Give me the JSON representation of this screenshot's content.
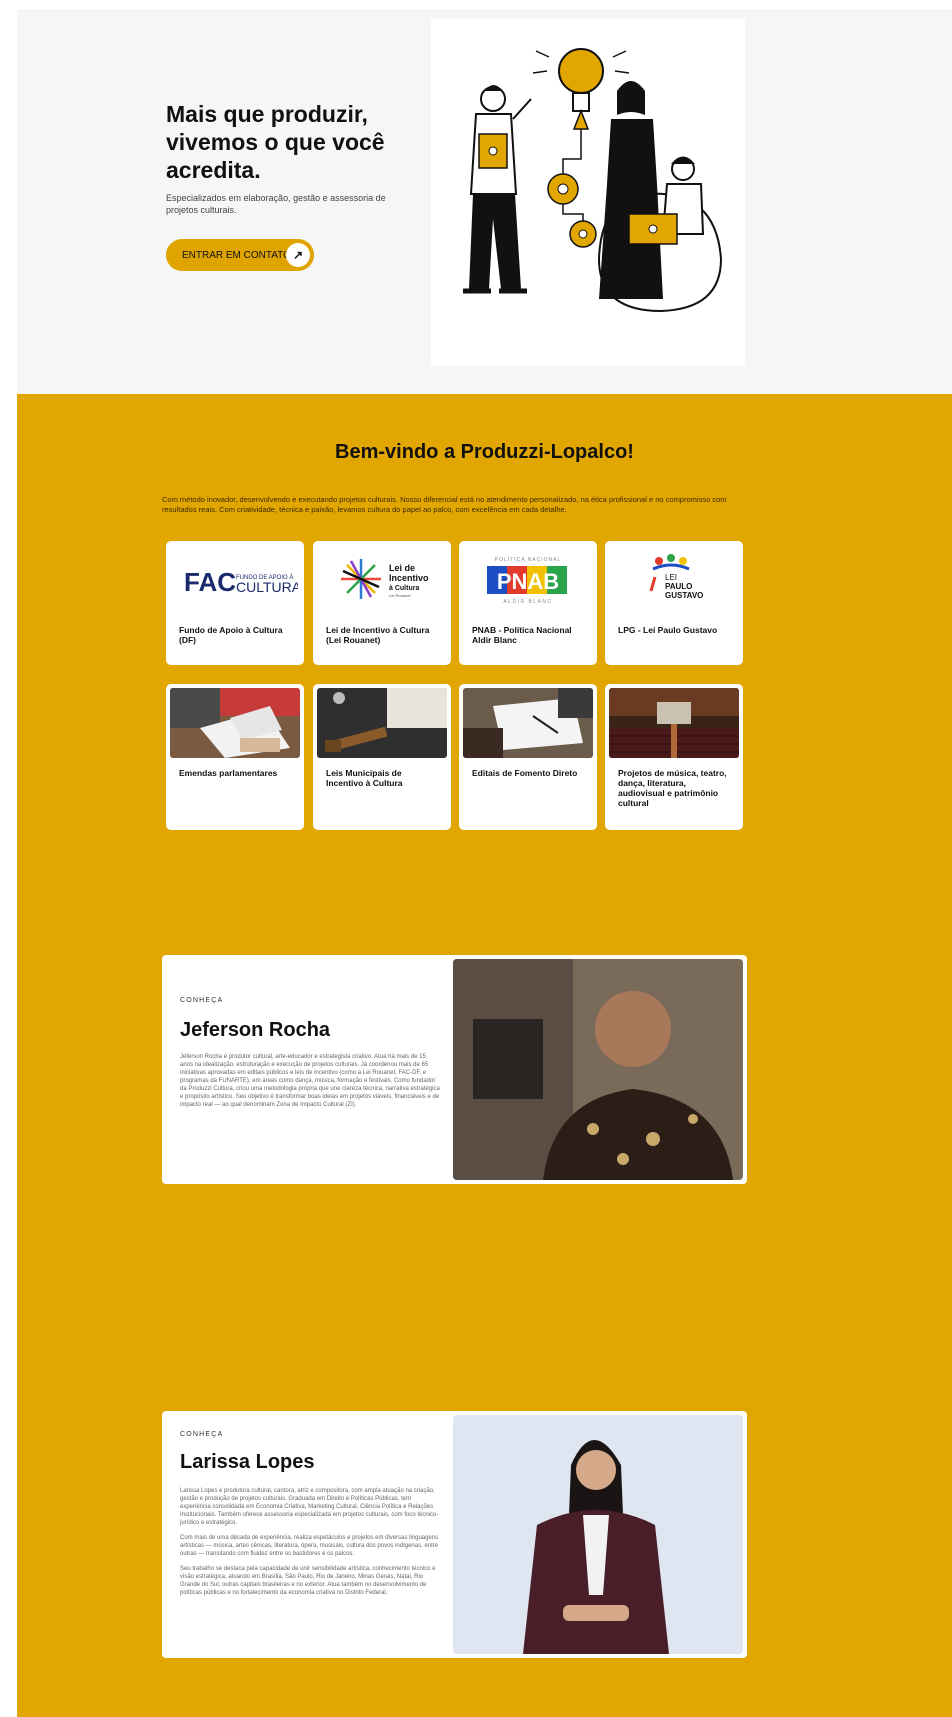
{
  "hero": {
    "title": "Mais que produzir, vivemos o que você acredita.",
    "subtitle": "Especializados em elaboração, gestão e assessoria de projetos culturais.",
    "cta_label": "ENTRAR EM CONTATO",
    "cta_icon": "arrow-up-right-icon"
  },
  "welcome": {
    "title": "Bem-vindo a Produzzi-Lopalco!",
    "text": "Com método inovador, desenvolvendo e executando projetos culturais. Nosso diferencial está no atendimento personalizado, na ética profissional e no compromisso com resultados reais. Com criatividade, técnica e paixão, levamos cultura do papel ao palco, com excelência em cada detalhe."
  },
  "cards": [
    {
      "label": "Fundo de Apoio à Cultura (DF)",
      "logo_main": "FAC",
      "logo_small_top": "FUNDO DE APOIO À",
      "logo_small_bottom": "CULTURA"
    },
    {
      "label": "Lei de Incentivo à Cultura (Lei Rouanet)",
      "logo_line1": "Lei de",
      "logo_line2": "Incentivo",
      "logo_line3": "à Cultura",
      "logo_line4": "Lei Rouanet"
    },
    {
      "label": "PNAB - Política Nacional Aldir Blanc",
      "logo_top": "POLÍTICA NACIONAL",
      "logo_main": "PNAB",
      "logo_bottom": "ALDIR BLANC"
    },
    {
      "label": "LPG - Lei Paulo Gustavo",
      "logo_line1": "LEI",
      "logo_line2": "PAULO",
      "logo_line3": "GUSTAVO"
    },
    {
      "label": "Emendas parlamentares"
    },
    {
      "label": "Leis Municipais de Incentivo à Cultura"
    },
    {
      "label": "Editais de Fomento Direto"
    },
    {
      "label": "Projetos de música, teatro, dança, literatura, audiovisual e patrimônio cultural"
    }
  ],
  "profiles": [
    {
      "kicker": "CONHEÇA",
      "name": "Jeferson Rocha",
      "bio": [
        "Jeferson Rocha é produtor cultural, arte-educador e estrategista criativo. Atua há mais de 15 anos na idealização, estruturação e execução de projetos culturais. Já coordenou mais de 65 iniciativas aprovadas em editais públicos e leis de incentivo (como a Lei Rouanet, FAC-DF, e programas da FUNARTE), em áreas como dança, música, formação e festivais. Como fundador da Produzzi Cultura, criou uma metodologia própria que une clareza técnica, narrativa estratégica e propósito artístico. Seu objetivo é transformar boas ideias em projetos viáveis, financiáveis e de impacto real — ao qual denominam Zona de Impacto Cultural (ZI)."
      ]
    },
    {
      "kicker": "CONHEÇA",
      "name": "Larissa Lopes",
      "bio": [
        "Larissa Lopes é produtora cultural, cantora, atriz e compositora, com ampla atuação na criação, gestão e produção de projetos culturais. Graduada em Direito e Políticas Públicas, tem experiência consolidada em Economia Criativa, Marketing Cultural, Ciência Política e Relações Institucionais. Também oferece assessoria especializada em projetos culturais, com foco técnico-jurídico e estratégico.",
        "Com mais de uma década de experiência, realiza espetáculos e projetos em diversas linguagens artísticas — música, artes cênicas, literatura, ópera, musicais, cultura dos povos indígenas, entre outras — transitando com fluidez entre os bastidores e os palcos.",
        "Seu trabalho se destaca pela capacidade de unir sensibilidade artística, conhecimento técnico e visão estratégica, atuando em Brasília, São Paulo, Rio de Janeiro, Minas Gerais, Natal, Rio Grande do Sul, outras capitais brasileiras e no exterior. Atua também no desenvolvimento de políticas públicas e no fortalecimento da economia criativa no Distrito Federal."
      ]
    }
  ],
  "colors": {
    "accent": "#e2a600",
    "hero_bg": "#f6f6f6",
    "card_bg": "#ffffff"
  }
}
